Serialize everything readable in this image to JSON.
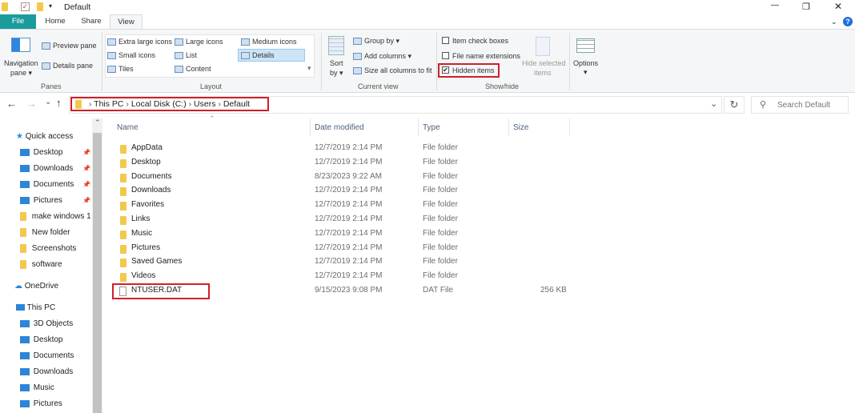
{
  "window": {
    "title": "Default",
    "minimize": "—",
    "maximize": "❐",
    "close": "✕",
    "help": "?"
  },
  "tabs": [
    {
      "label": "File"
    },
    {
      "label": "Home"
    },
    {
      "label": "Share"
    },
    {
      "label": "View"
    }
  ],
  "ribbon": {
    "panes": {
      "navigation_pane": "Navigation",
      "navigation_pane2": "pane ▾",
      "preview_pane": "Preview pane",
      "details_pane": "Details pane",
      "group": "Panes"
    },
    "layout": {
      "items": [
        "Extra large icons",
        "Large icons",
        "Medium icons",
        "Small icons",
        "List",
        "Details",
        "Tiles",
        "Content"
      ],
      "selected": "Details",
      "group": "Layout"
    },
    "current_view": {
      "sort": "Sort",
      "sort2": "by ▾",
      "group_by": "Group by ▾",
      "add_columns": "Add columns ▾",
      "size_columns": "Size all columns to fit",
      "group": "Current view"
    },
    "show_hide": {
      "item_check_boxes": "Item check boxes",
      "file_name_extensions": "File name extensions",
      "hidden_items": "Hidden items",
      "hidden_items_checked": true,
      "hide_selected": "Hide selected",
      "hide_selected2": "items",
      "group": "Show/hide"
    },
    "options": {
      "label": "Options",
      "arrow": "▾"
    }
  },
  "address": {
    "crumbs": [
      "This PC",
      "Local Disk (C:)",
      "Users",
      "Default"
    ],
    "search_placeholder": "Search Default"
  },
  "nav": {
    "back": "←",
    "forward": "→",
    "recent": "⌄",
    "up": "↑",
    "refresh": "↻",
    "dropdown": "⌄"
  },
  "sidebar": {
    "quick_access": "Quick access",
    "quick_items": [
      {
        "label": "Desktop",
        "pinned": true
      },
      {
        "label": "Downloads",
        "pinned": true
      },
      {
        "label": "Documents",
        "pinned": true
      },
      {
        "label": "Pictures",
        "pinned": true
      },
      {
        "label": "make windows 1"
      },
      {
        "label": "New folder"
      },
      {
        "label": "Screenshots"
      },
      {
        "label": "software"
      }
    ],
    "onedrive": "OneDrive",
    "this_pc": "This PC",
    "pc_items": [
      {
        "label": "3D Objects"
      },
      {
        "label": "Desktop"
      },
      {
        "label": "Documents"
      },
      {
        "label": "Downloads"
      },
      {
        "label": "Music"
      },
      {
        "label": "Pictures"
      }
    ]
  },
  "columns": {
    "name": "Name",
    "date": "Date modified",
    "type": "Type",
    "size": "Size"
  },
  "files": [
    {
      "name": "AppData",
      "date": "12/7/2019 2:14 PM",
      "type": "File folder",
      "size": ""
    },
    {
      "name": "Desktop",
      "date": "12/7/2019 2:14 PM",
      "type": "File folder",
      "size": ""
    },
    {
      "name": "Documents",
      "date": "8/23/2023 9:22 AM",
      "type": "File folder",
      "size": ""
    },
    {
      "name": "Downloads",
      "date": "12/7/2019 2:14 PM",
      "type": "File folder",
      "size": ""
    },
    {
      "name": "Favorites",
      "date": "12/7/2019 2:14 PM",
      "type": "File folder",
      "size": ""
    },
    {
      "name": "Links",
      "date": "12/7/2019 2:14 PM",
      "type": "File folder",
      "size": ""
    },
    {
      "name": "Music",
      "date": "12/7/2019 2:14 PM",
      "type": "File folder",
      "size": ""
    },
    {
      "name": "Pictures",
      "date": "12/7/2019 2:14 PM",
      "type": "File folder",
      "size": ""
    },
    {
      "name": "Saved Games",
      "date": "12/7/2019 2:14 PM",
      "type": "File folder",
      "size": ""
    },
    {
      "name": "Videos",
      "date": "12/7/2019 2:14 PM",
      "type": "File folder",
      "size": ""
    },
    {
      "name": "NTUSER.DAT",
      "date": "9/15/2023 9:08 PM",
      "type": "DAT File",
      "size": "256 KB"
    }
  ],
  "colors": {
    "file_tab": "#1a9c9c",
    "highlight": "#d0202a",
    "selected": "#cce4f7"
  }
}
